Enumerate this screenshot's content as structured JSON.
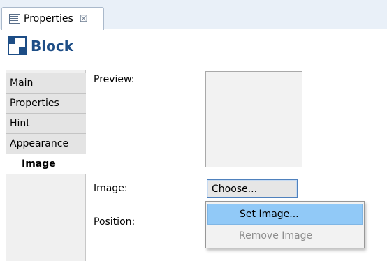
{
  "tab": {
    "label": "Properties",
    "icon": "properties-view-icon",
    "close_glyph": "☒"
  },
  "header": {
    "title": "Block",
    "icon": "block-icon"
  },
  "nav": {
    "items": [
      {
        "label": "Main"
      },
      {
        "label": "Properties"
      },
      {
        "label": "Hint"
      },
      {
        "label": "Appearance"
      },
      {
        "label": "Image",
        "selected": true
      }
    ]
  },
  "form": {
    "preview_label": "Preview:",
    "image_label": "Image:",
    "position_label": "Position:",
    "choose_button": "Choose..."
  },
  "menu": {
    "items": [
      {
        "label": "Set Image...",
        "highlighted": true
      },
      {
        "label": "Remove Image",
        "disabled": true
      }
    ]
  },
  "colors": {
    "accent": "#1d4d86",
    "menu_highlight": "#91c9f7",
    "tabstrip": "#e9f0f8"
  }
}
